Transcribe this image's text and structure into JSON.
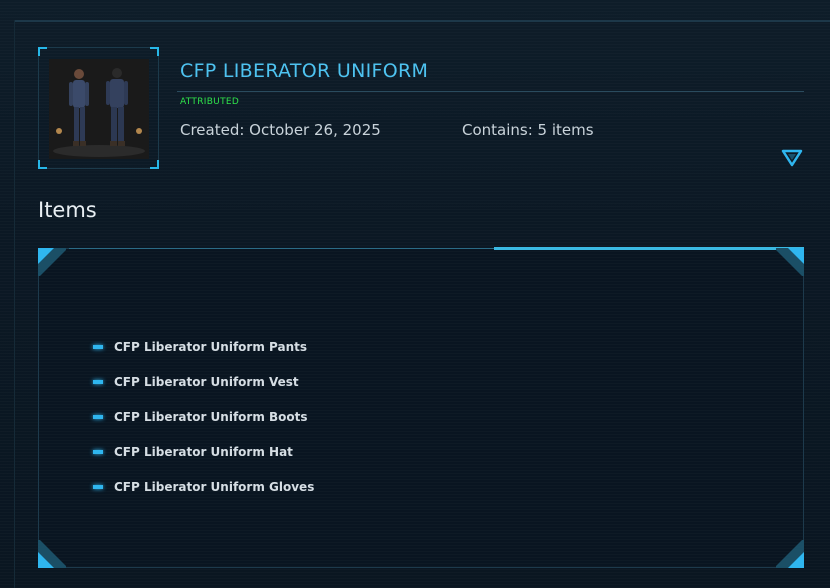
{
  "item": {
    "title": "CFP LIBERATOR UNIFORM",
    "badge": "ATTRIBUTED",
    "created": "Created: October 26, 2025",
    "contains": "Contains: 5 items",
    "thumbnail_icon": "uniform-thumbnail"
  },
  "collapse_toggle_icon": "triangle-down-icon",
  "items_section": {
    "heading": "Items",
    "entries": [
      {
        "label": "CFP Liberator Uniform Pants"
      },
      {
        "label": "CFP Liberator Uniform Vest"
      },
      {
        "label": "CFP Liberator Uniform Boots"
      },
      {
        "label": "CFP Liberator Uniform Hat"
      },
      {
        "label": "CFP Liberator Uniform Gloves"
      }
    ]
  },
  "colors": {
    "accent": "#2fb6ef",
    "title": "#4ec3f0",
    "badge": "#2fe24a",
    "background": "#0b1722"
  }
}
